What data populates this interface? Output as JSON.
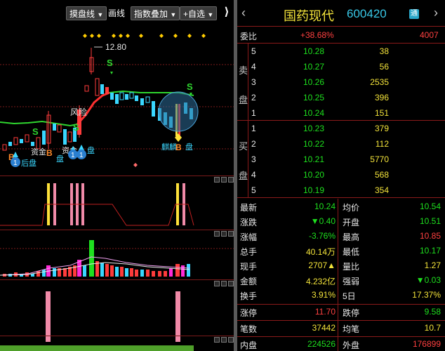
{
  "toolbar": {
    "trend_line": "摸盘线",
    "draw_line": "画线",
    "index_overlay": "指数叠加",
    "add_watchlist": "+自选",
    "close": "✕"
  },
  "chart": {
    "high_label": "12.80",
    "annotations": {
      "s1": "S",
      "s2": "S",
      "s3": "S",
      "s4": "S",
      "b1": "B",
      "b2": "B",
      "b3": "B",
      "feng": "风险",
      "zhong": "资金",
      "jinkou": "资金",
      "hou": "后盘",
      "mid1": "盘",
      "mid2": "盘",
      "right1": "麒麟",
      "right2": "盘",
      "circle1": "1",
      "circle2": "1",
      "circle3": "1"
    },
    "colors": {
      "up": "#ff3b3b",
      "down": "#3ad7ff",
      "ma": "#2fd62f",
      "accent_yellow": "#ffe23a",
      "pink": "#f08aa8"
    }
  },
  "quote": {
    "name": "国药现代",
    "code": "600420",
    "tag": "通",
    "weibi_label": "委比",
    "weibi_value": "+38.68%",
    "weibi_diff": "4007",
    "sell_label_1": "卖",
    "sell_label_2": "盘",
    "buy_label_1": "买",
    "buy_label_2": "盘",
    "sell": [
      {
        "level": "5",
        "price": "10.28",
        "vol": "38"
      },
      {
        "level": "4",
        "price": "10.27",
        "vol": "56"
      },
      {
        "level": "3",
        "price": "10.26",
        "vol": "2535"
      },
      {
        "level": "2",
        "price": "10.25",
        "vol": "396"
      },
      {
        "level": "1",
        "price": "10.24",
        "vol": "151"
      }
    ],
    "buy": [
      {
        "level": "1",
        "price": "10.23",
        "vol": "379"
      },
      {
        "level": "2",
        "price": "10.22",
        "vol": "112"
      },
      {
        "level": "3",
        "price": "10.21",
        "vol": "5770"
      },
      {
        "level": "4",
        "price": "10.20",
        "vol": "568"
      },
      {
        "level": "5",
        "price": "10.19",
        "vol": "354"
      }
    ],
    "stats": {
      "latest_label": "最新",
      "latest": "10.24",
      "avg_label": "均价",
      "avg": "10.54",
      "change_label": "涨跌",
      "change": "▼0.40",
      "open_label": "开盘",
      "open": "10.51",
      "pct_label": "涨幅",
      "pct": "-3.76%",
      "high_label": "最高",
      "high": "10.85",
      "total_label": "总手",
      "total": "40.14万",
      "low_label": "最低",
      "low": "10.17",
      "now_label": "现手",
      "now": "2707▲",
      "ratio_label": "量比",
      "ratio": "1.27",
      "amount_label": "金额",
      "amount": "4.232亿",
      "strength_label": "强弱",
      "strength": "▼0.03",
      "turnover_label": "换手",
      "turnover": "3.91%",
      "five_label": "5日",
      "five": "17.37%",
      "limitup_label": "涨停",
      "limitup": "11.70",
      "limitdown_label": "跌停",
      "limitdown": "9.58",
      "trades_label": "笔数",
      "trades": "37442",
      "avgtrade_label": "均笔",
      "avgtrade": "10.7",
      "inner_label": "内盘",
      "inner": "224526",
      "outer_label": "外盘",
      "outer": "176899"
    }
  }
}
